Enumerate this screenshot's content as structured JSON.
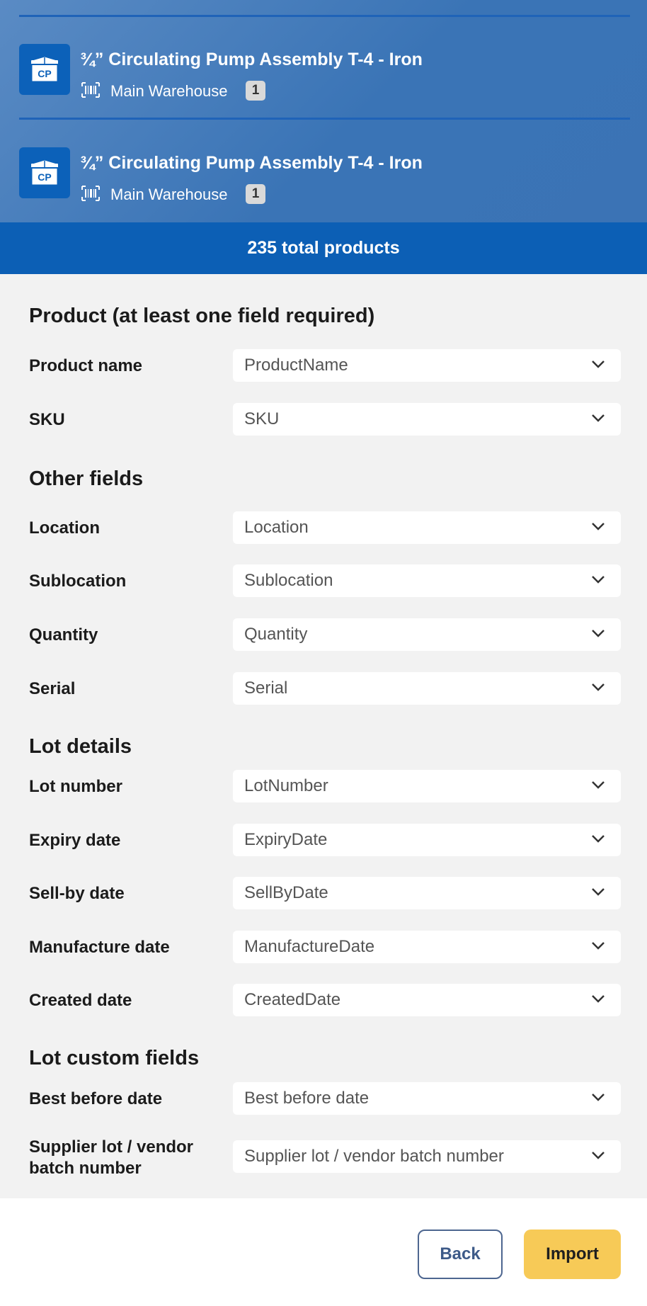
{
  "preview": {
    "items": [
      {
        "icon_text": "CP",
        "title": "¾” Circulating Pump Assembly T-4 - Iron",
        "location": "Main Warehouse",
        "qty": "1"
      },
      {
        "icon_text": "CP",
        "title": "¾” Circulating Pump Assembly T-4 - Iron",
        "location": "Main Warehouse",
        "qty": "1"
      }
    ],
    "total": "235 total products"
  },
  "form": {
    "product_section": "Product (at least one field required)",
    "other_section": "Other fields",
    "lot_section": "Lot details",
    "lot_custom_section": "Lot custom fields",
    "fields": {
      "product_name": {
        "label": "Product name",
        "value": "ProductName"
      },
      "sku": {
        "label": "SKU",
        "value": "SKU"
      },
      "location": {
        "label": "Location",
        "value": "Location"
      },
      "sublocation": {
        "label": "Sublocation",
        "value": "Sublocation"
      },
      "quantity": {
        "label": "Quantity",
        "value": "Quantity"
      },
      "serial": {
        "label": "Serial",
        "value": "Serial"
      },
      "lot_number": {
        "label": "Lot number",
        "value": "LotNumber"
      },
      "expiry_date": {
        "label": "Expiry date",
        "value": "ExpiryDate"
      },
      "sell_by_date": {
        "label": "Sell-by date",
        "value": "SellByDate"
      },
      "manufacture_date": {
        "label": "Manufacture date",
        "value": "ManufactureDate"
      },
      "created_date": {
        "label": "Created date",
        "value": "CreatedDate"
      },
      "best_before_date": {
        "label": "Best before date",
        "value": "Best before date"
      },
      "supplier_lot": {
        "label": "Supplier lot / vendor batch number",
        "value": "Supplier lot / vendor batch number"
      }
    }
  },
  "footer": {
    "back_label": "Back",
    "import_label": "Import"
  },
  "colors": {
    "primary": "#0c5fb5",
    "import_button": "#f7ca57",
    "back_border": "#4d6690"
  }
}
